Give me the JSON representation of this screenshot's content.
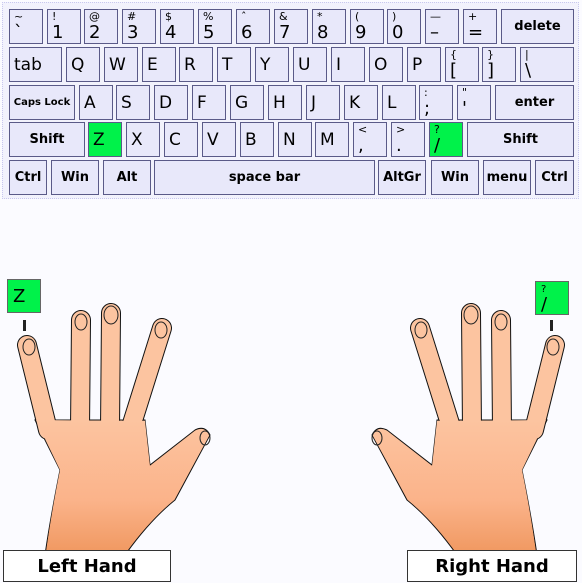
{
  "keyboard": {
    "highlight_color": "#00f24a",
    "rows": [
      [
        {
          "t": "~",
          "m": "`"
        },
        {
          "t": "!",
          "m": "1"
        },
        {
          "t": "@",
          "m": "2"
        },
        {
          "t": "#",
          "m": "3"
        },
        {
          "t": "$",
          "m": "4"
        },
        {
          "t": "%",
          "m": "5"
        },
        {
          "t": "ˆ",
          "m": "6"
        },
        {
          "t": "&",
          "m": "7"
        },
        {
          "t": "*",
          "m": "8"
        },
        {
          "t": "(",
          "m": "9"
        },
        {
          "t": ")",
          "m": "0"
        },
        {
          "t": "—",
          "m": "–"
        },
        {
          "t": "+",
          "m": "="
        },
        {
          "c": "delete"
        }
      ],
      [
        {
          "l": "tab"
        },
        {
          "l": "Q"
        },
        {
          "l": "W"
        },
        {
          "l": "E"
        },
        {
          "l": "R"
        },
        {
          "l": "T"
        },
        {
          "l": "Y"
        },
        {
          "l": "U"
        },
        {
          "l": "I"
        },
        {
          "l": "O"
        },
        {
          "l": "P"
        },
        {
          "t": "{",
          "m": "["
        },
        {
          "t": "}",
          "m": "]"
        },
        {
          "t": "|",
          "m": "\\"
        }
      ],
      [
        {
          "c": "Caps Lock",
          "small": true
        },
        {
          "l": "A"
        },
        {
          "l": "S"
        },
        {
          "l": "D"
        },
        {
          "l": "F"
        },
        {
          "l": "G"
        },
        {
          "l": "H"
        },
        {
          "l": "J"
        },
        {
          "l": "K"
        },
        {
          "l": "L"
        },
        {
          "t": ":",
          "m": ";"
        },
        {
          "t": "\"",
          "m": "'"
        },
        {
          "c": "enter"
        }
      ],
      [
        {
          "c": "Shift"
        },
        {
          "l": "Z",
          "hl": true
        },
        {
          "l": "X"
        },
        {
          "l": "C"
        },
        {
          "l": "V"
        },
        {
          "l": "B"
        },
        {
          "l": "N"
        },
        {
          "l": "M"
        },
        {
          "t": "<",
          "m": ","
        },
        {
          "t": ">",
          "m": "."
        },
        {
          "t": "?",
          "m": "/",
          "hl": true
        },
        {
          "c": "Shift"
        }
      ],
      [
        {
          "c": "Ctrl"
        },
        {
          "c": "Win"
        },
        {
          "c": "Alt"
        },
        {
          "c": "space bar"
        },
        {
          "c": "AltGr"
        },
        {
          "c": "Win"
        },
        {
          "c": "menu"
        },
        {
          "c": "Ctrl"
        }
      ]
    ]
  },
  "left_hand": {
    "label": "Left Hand",
    "finger_key": "Z",
    "finger": "pinky"
  },
  "right_hand": {
    "label": "Right Hand",
    "finger_key_top": "?",
    "finger_key": "/",
    "finger": "pinky"
  },
  "skin_color": "#fbb68f"
}
